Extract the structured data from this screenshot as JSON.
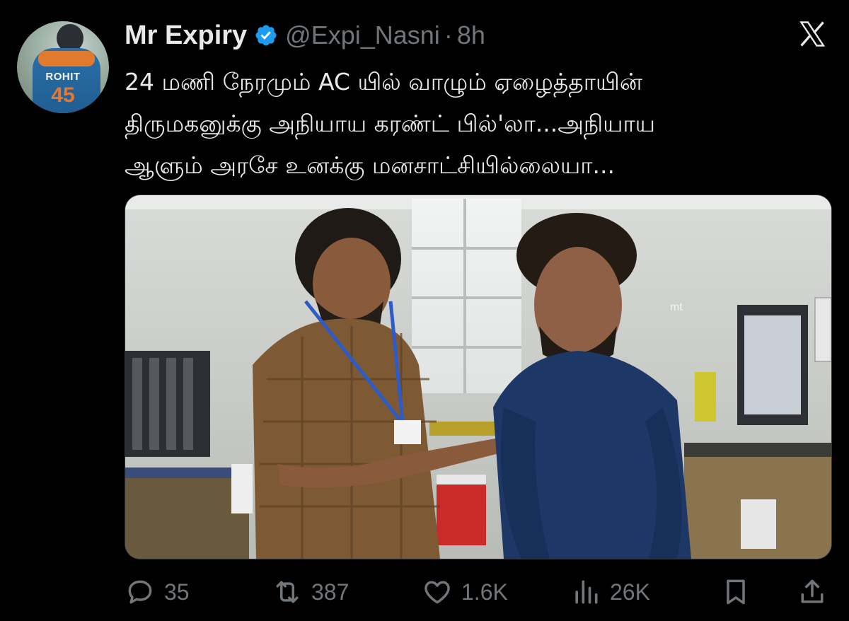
{
  "tweet": {
    "author_name": "Mr Expiry",
    "handle": "@Expi_Nasni",
    "separator": "·",
    "time": "8h",
    "text_lines": [
      "24 மணி நேரமும் AC யில் வாழும் ஏழைத்தாயின்",
      "திருமகனுக்கு அநியாய கரண்ட் பில்'லா...அநியாய",
      "ஆளும் அரசே உனக்கு மனசாட்சியில்லையா..."
    ],
    "avatar": {
      "jersey_name": "ROHIT",
      "jersey_number": "45"
    },
    "media": {
      "watermark": "mt"
    }
  },
  "stats": {
    "replies": "35",
    "reposts": "387",
    "likes": "1.6K",
    "views": "26K"
  },
  "icons": {
    "verified": "verified-badge-icon",
    "x_logo": "x-logo-icon",
    "reply": "reply-icon",
    "repost": "repost-icon",
    "like": "heart-icon",
    "views": "views-chart-icon",
    "bookmark": "bookmark-icon",
    "share": "share-icon"
  },
  "colors": {
    "background": "#000000",
    "text": "#e7e9ea",
    "secondary": "#71767b",
    "verified": "#1d9bf0"
  }
}
